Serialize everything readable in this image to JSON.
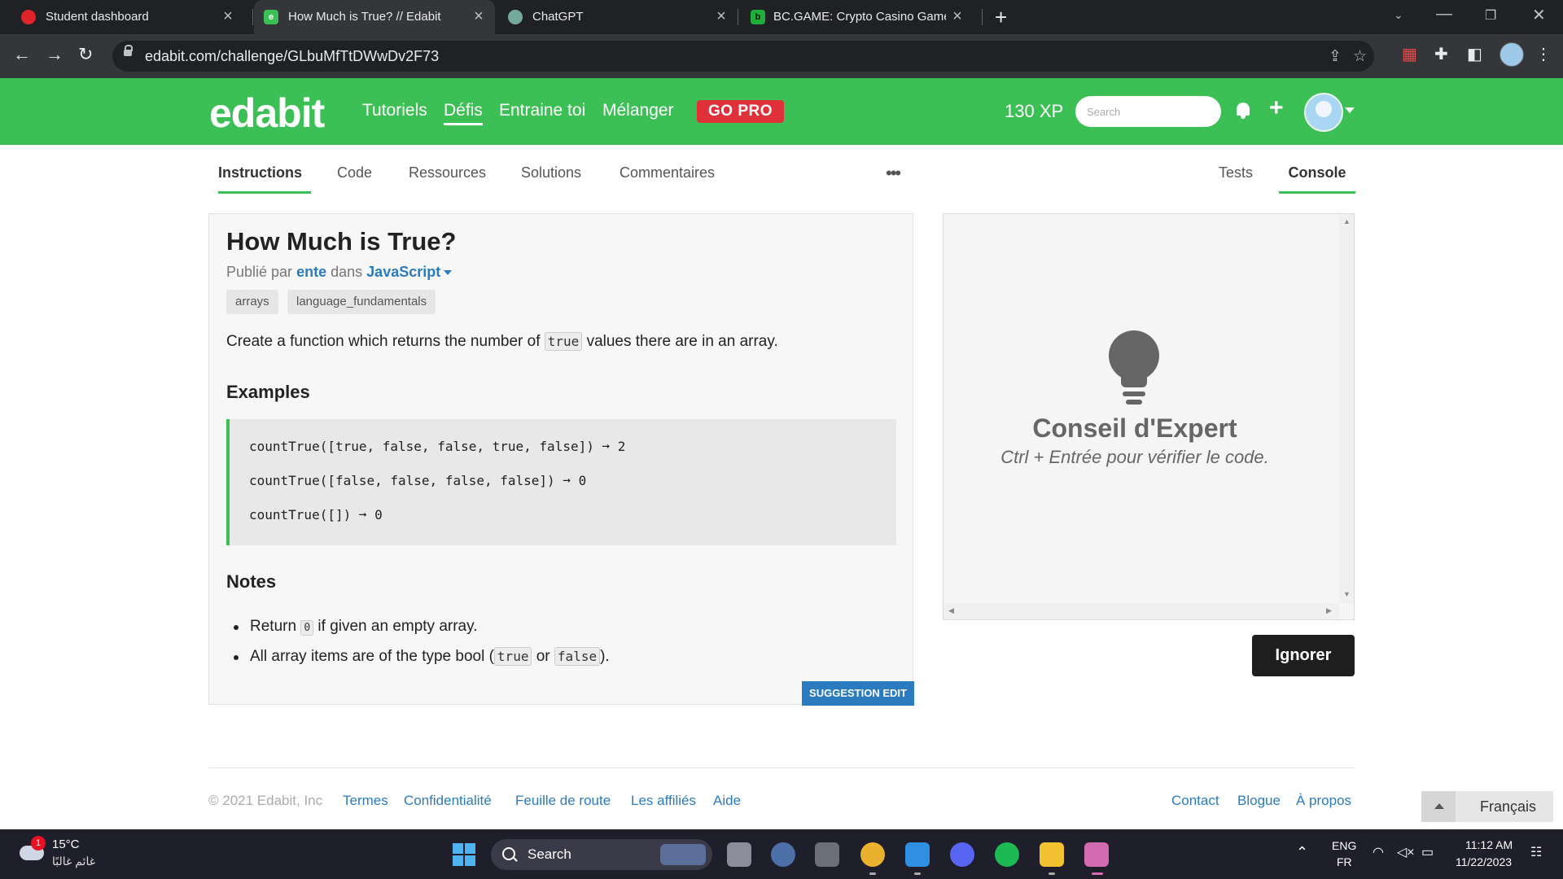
{
  "browser": {
    "tabs": [
      {
        "title": "Student dashboard",
        "icon": "opera-icon",
        "color": "#e0242a"
      },
      {
        "title": "How Much is True? // Edabit",
        "icon": "edabit-icon",
        "color": "#3cbf55",
        "active": true
      },
      {
        "title": "ChatGPT",
        "icon": "chatgpt-icon",
        "color": "#74aa9c"
      },
      {
        "title": "BC.GAME: Crypto Casino Games",
        "icon": "bcgame-icon",
        "color": "#1fae3a"
      }
    ],
    "url": "edabit.com/challenge/GLbuMfTtDWwDv2F73"
  },
  "header": {
    "logo": "edabit",
    "nav": [
      "Tutoriels",
      "Défis",
      "Entraine toi",
      "Mélanger"
    ],
    "active_nav": "Défis",
    "gopro": "GO PRO",
    "xp": "130 XP",
    "search_placeholder": "Search"
  },
  "subtabs": {
    "left": [
      "Instructions",
      "Code",
      "Ressources",
      "Solutions",
      "Commentaires"
    ],
    "right": [
      "Tests",
      "Console"
    ],
    "more": "•••"
  },
  "challenge": {
    "title": "How Much is True?",
    "published_by": "Publié par",
    "author": "ente",
    "in": "dans",
    "language": "JavaScript",
    "tags": [
      "arrays",
      "language_fundamentals"
    ],
    "desc_before": "Create a function which returns the number of",
    "desc_code": "true",
    "desc_after": "values there are in an array.",
    "examples_heading": "Examples",
    "examples": [
      "countTrue([true, false, false, true, false]) ➞ 2",
      "countTrue([false, false, false, false]) ➞ 0",
      "countTrue([]) ➞ 0"
    ],
    "notes_heading": "Notes",
    "note1_before": "Return",
    "note1_code": "0",
    "note1_after": "if given an empty array.",
    "note2_before": "All array items are of the type bool (",
    "note2_code1": "true",
    "note2_mid": "or",
    "note2_code2": "false",
    "note2_after": ").",
    "suggestion": "SUGGESTION EDIT"
  },
  "console": {
    "tip_title": "Conseil d'Expert",
    "tip_sub": "Ctrl + Entrée pour vérifier le code.",
    "ignore": "Ignorer"
  },
  "footer": {
    "copyright": "© 2021 Edabit, Inc",
    "links_left": [
      "Termes",
      "Confidentialité",
      "Feuille de route",
      "Les affiliés",
      "Aide"
    ],
    "links_right": [
      "Contact",
      "Blogue",
      "À propos"
    ],
    "language": "Français"
  },
  "taskbar": {
    "weather_badge": "1",
    "temperature": "15°C",
    "weather_desc": "غائم غالبًا",
    "search": "Search",
    "lang_top": "ENG",
    "lang_bottom": "FR",
    "time": "11:12 AM",
    "date": "11/22/2023"
  },
  "colors": {
    "brand_green": "#3cbf55",
    "gopro_red": "#e0313b",
    "link_blue": "#2b7bc0"
  }
}
